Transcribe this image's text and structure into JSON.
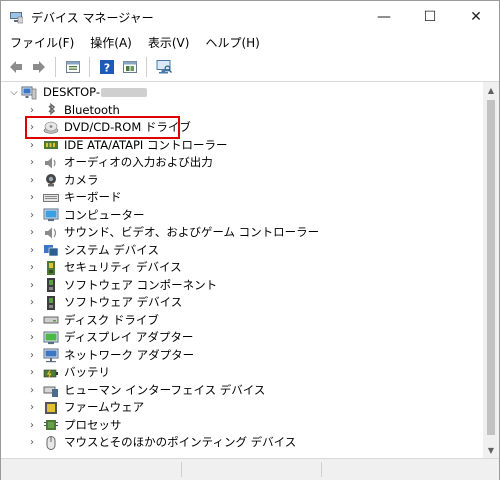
{
  "title": "デバイス マネージャー",
  "window_controls": {
    "minimize": "—",
    "maximize": "☐",
    "close": "✕"
  },
  "menu": [
    "ファイル(F)",
    "操作(A)",
    "表示(V)",
    "ヘルプ(H)"
  ],
  "toolbar": [
    "back-icon",
    "forward-icon",
    "properties-icon",
    "help-icon",
    "update-driver-icon",
    "scan-hardware-icon"
  ],
  "tree": {
    "root_label": "DESKTOP-",
    "root_expanded": true,
    "items": [
      {
        "label": "Bluetooth",
        "icon": "bluetooth-icon"
      },
      {
        "label": "DVD/CD-ROM ドライブ",
        "icon": "dvd-drive-icon"
      },
      {
        "label": "IDE ATA/ATAPI コントローラー",
        "icon": "ide-controller-icon"
      },
      {
        "label": "オーディオの入力および出力",
        "icon": "audio-icon"
      },
      {
        "label": "カメラ",
        "icon": "camera-icon"
      },
      {
        "label": "キーボード",
        "icon": "keyboard-icon"
      },
      {
        "label": "コンピューター",
        "icon": "computer-icon"
      },
      {
        "label": "サウンド、ビデオ、およびゲーム コントローラー",
        "icon": "sound-icon"
      },
      {
        "label": "システム デバイス",
        "icon": "system-device-icon"
      },
      {
        "label": "セキュリティ デバイス",
        "icon": "security-device-icon"
      },
      {
        "label": "ソフトウェア コンポーネント",
        "icon": "software-component-icon"
      },
      {
        "label": "ソフトウェア デバイス",
        "icon": "software-device-icon"
      },
      {
        "label": "ディスク ドライブ",
        "icon": "disk-drive-icon"
      },
      {
        "label": "ディスプレイ アダプター",
        "icon": "display-adapter-icon"
      },
      {
        "label": "ネットワーク アダプター",
        "icon": "network-adapter-icon"
      },
      {
        "label": "バッテリ",
        "icon": "battery-icon"
      },
      {
        "label": "ヒューマン インターフェイス デバイス",
        "icon": "hid-icon"
      },
      {
        "label": "ファームウェア",
        "icon": "firmware-icon"
      },
      {
        "label": "プロセッサ",
        "icon": "processor-icon"
      },
      {
        "label": "マウスとそのほかのポインティング デバイス",
        "icon": "mouse-icon"
      }
    ]
  },
  "highlighted_item": "DVD/CD-ROM ドライブ",
  "colors": {
    "highlight_border": "#e00000",
    "toolbar_icon_blue": "#1e5bb8",
    "window_border": "#9a9a9a"
  }
}
